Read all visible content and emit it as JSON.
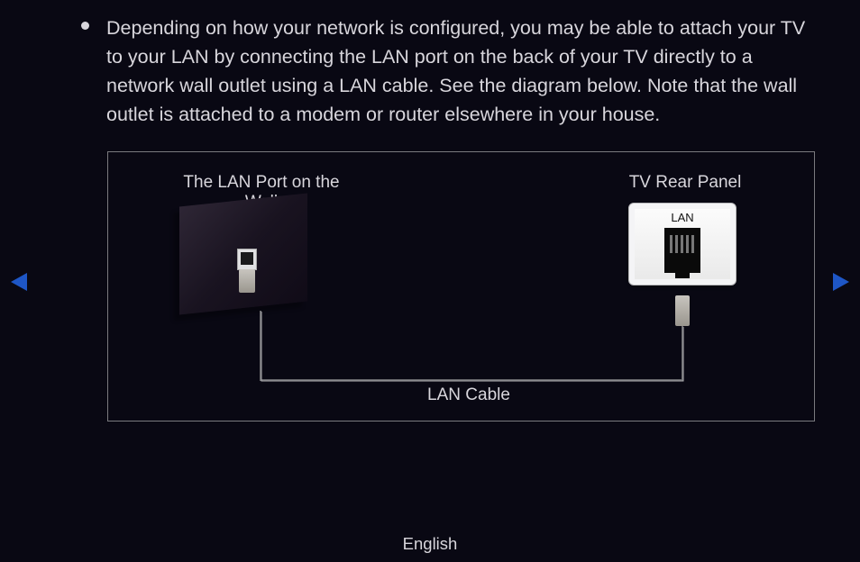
{
  "body": {
    "paragraph": "Depending on how your network is configured, you may be able to attach your TV to your LAN by connecting the LAN port on the back of your TV directly to a network wall outlet using a LAN cable. See the diagram below. Note that the wall outlet is attached to a modem or router elsewhere in your house."
  },
  "diagram": {
    "wall_label": "The LAN Port on the Wall",
    "tv_label": "TV Rear Panel",
    "cable_label": "LAN Cable",
    "lan_port_text": "LAN"
  },
  "footer": {
    "language": "English"
  }
}
